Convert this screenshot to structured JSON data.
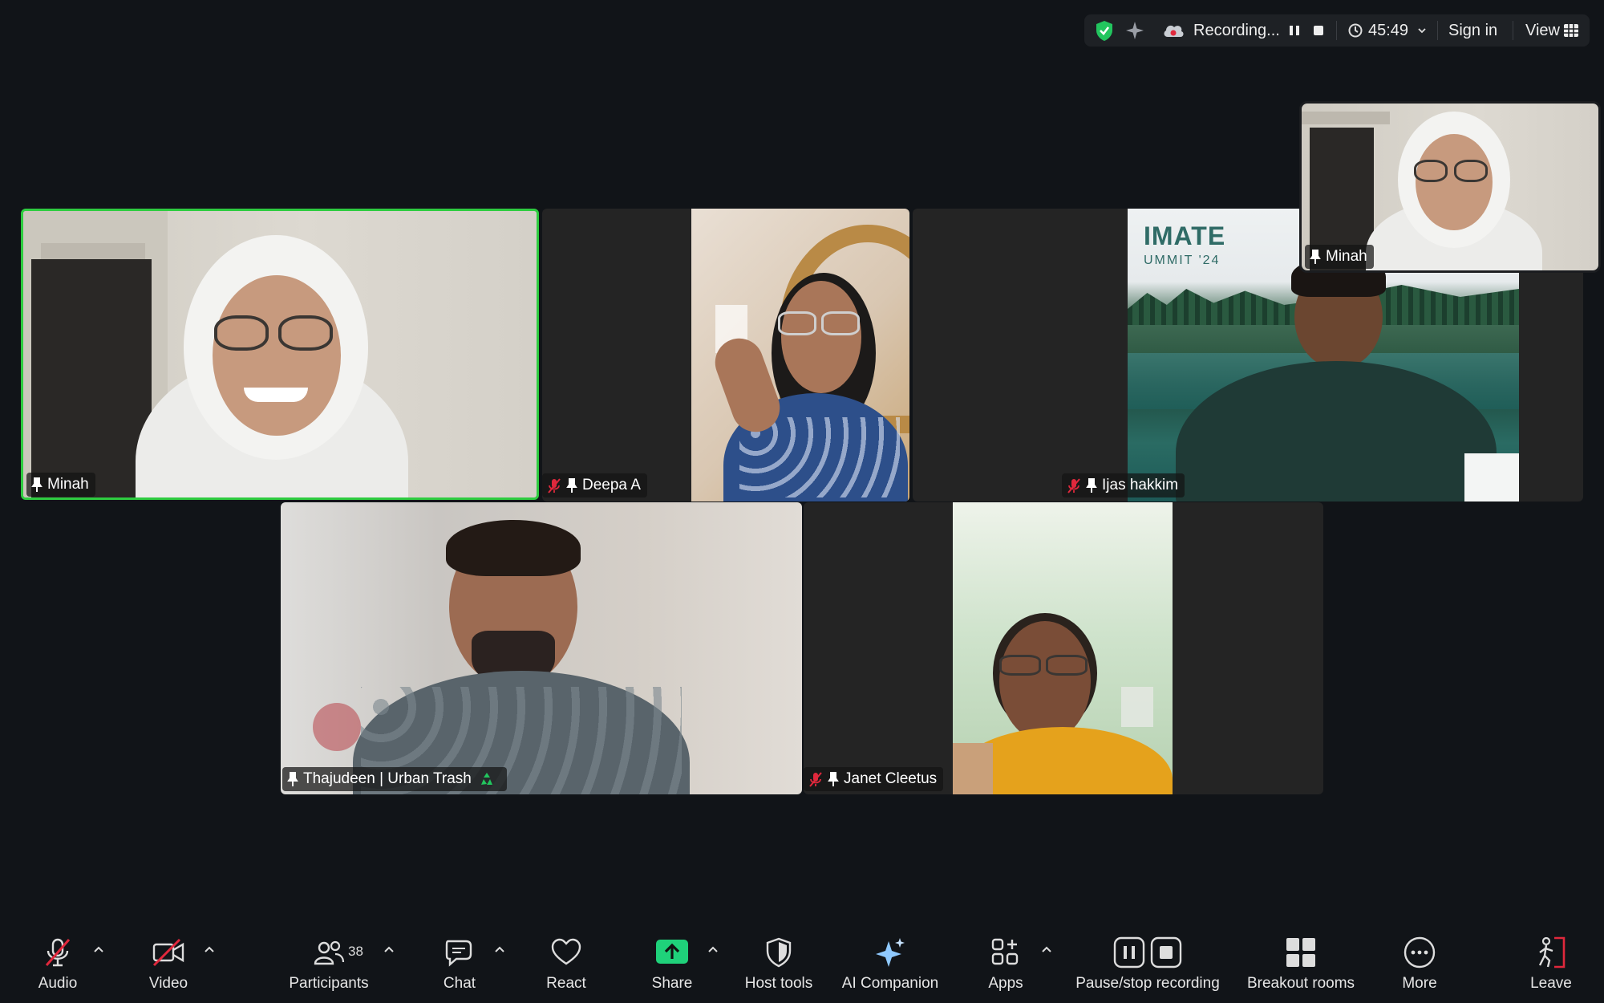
{
  "topbar": {
    "recording_label": "Recording...",
    "timer": "45:49",
    "signin_label": "Sign in",
    "view_label": "View"
  },
  "participants": [
    {
      "name": "Minah"
    },
    {
      "name": "Deepa A"
    },
    {
      "name": "Ijas hakkim"
    },
    {
      "name": "Thajudeen | Urban Trash"
    },
    {
      "name": "Janet Cleetus"
    }
  ],
  "self_view": {
    "name": "Minah"
  },
  "slide_text": {
    "line1": "IMATE",
    "line2": "UMMIT '24"
  },
  "toolbar": {
    "audio": "Audio",
    "video": "Video",
    "participants": "Participants",
    "participants_count": "38",
    "chat": "Chat",
    "react": "React",
    "share": "Share",
    "host_tools": "Host tools",
    "ai_companion": "AI Companion",
    "apps": "Apps",
    "pause_stop_recording": "Pause/stop recording",
    "breakout_rooms": "Breakout rooms",
    "more": "More",
    "leave": "Leave"
  },
  "colors": {
    "background": "#111418",
    "active_speaker_border": "#2ecc40",
    "share_green": "#1fd17a",
    "muted_red": "#e0283c",
    "shield_green": "#22c55e"
  }
}
